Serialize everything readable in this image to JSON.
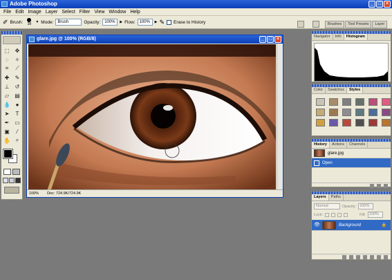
{
  "app": {
    "title": "Adobe Photoshop"
  },
  "menu": [
    "File",
    "Edit",
    "Image",
    "Layer",
    "Select",
    "Filter",
    "View",
    "Window",
    "Help"
  ],
  "options": {
    "brush_label": "Brush:",
    "brush_size": "38",
    "mode_label": "Mode:",
    "mode_value": "Brush",
    "opacity_label": "Opacity:",
    "opacity_value": "100%",
    "flow_label": "Flow:",
    "flow_value": "100%",
    "erase_history_label": "Erase to History"
  },
  "well_tabs": [
    "Brushes",
    "Tool Presets",
    "Layer"
  ],
  "document": {
    "title": "glare.jpg @ 100% (RGB/8)",
    "zoom": "100%",
    "doc_size": "Doc: 724.9K/724.9K"
  },
  "navigator_panel": {
    "tabs": [
      "Navigator",
      "Info",
      "Histogram"
    ]
  },
  "swatches_panel": {
    "tabs": [
      "Color",
      "Swatches",
      "Styles"
    ],
    "colors": [
      "#c8c3b4",
      "#a88b6a",
      "#7f7f7f",
      "#66706b",
      "#b94e7a",
      "#e05a84",
      "#c3ab76",
      "#9c7a50",
      "#8e8e8e",
      "#5c7a80",
      "#4a6d9a",
      "#8a4a86",
      "#d0a040",
      "#6a5aa8",
      "#b84a3c",
      "#505050",
      "#9a3a38",
      "#b8762e"
    ]
  },
  "history_panel": {
    "tabs": [
      "History",
      "Actions",
      "Channels"
    ],
    "snapshot": "glare.jpg",
    "step": "Open"
  },
  "layers_panel": {
    "tabs": [
      "Layers",
      "Paths"
    ],
    "blend_mode": "Normal",
    "opacity_label": "Opacity:",
    "opacity_value": "100%",
    "lock_label": "Lock:",
    "fill_label": "Fill:",
    "fill_value": "100%",
    "layer_name": "Background"
  }
}
